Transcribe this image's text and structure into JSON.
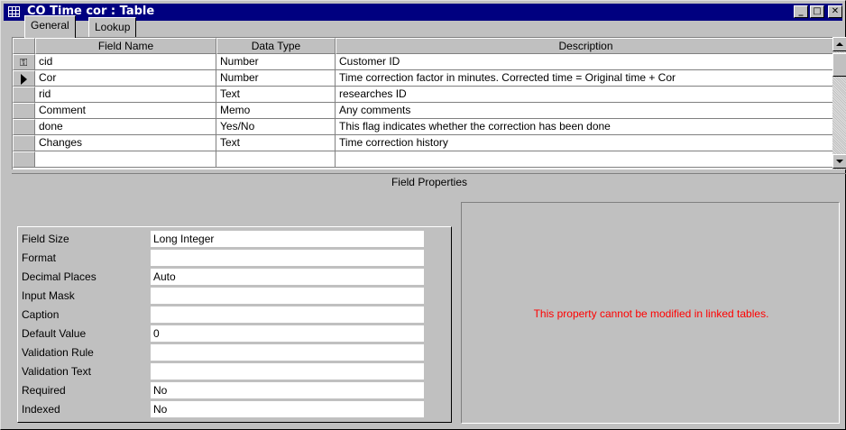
{
  "window": {
    "title": "CO Time cor : Table",
    "controls": {
      "minimize": "_",
      "maximize": "□",
      "close": "✕"
    }
  },
  "grid": {
    "columns": [
      "Field Name",
      "Data Type",
      "Description"
    ],
    "rows": [
      {
        "name": "cid",
        "type": "Number",
        "description": "Customer ID",
        "indicator": "key-icon"
      },
      {
        "name": "Cor",
        "type": "Number",
        "description": "Time correction factor in minutes. Corrected time = Original time + Cor",
        "indicator": "current-row-arrow"
      },
      {
        "name": "rid",
        "type": "Text",
        "description": "researches ID",
        "indicator": ""
      },
      {
        "name": "Comment",
        "type": "Memo",
        "description": "Any comments",
        "indicator": ""
      },
      {
        "name": "done",
        "type": "Yes/No",
        "description": "This flag indicates whether the correction has been done",
        "indicator": ""
      },
      {
        "name": "Changes",
        "type": "Text",
        "description": "Time correction history",
        "indicator": ""
      },
      {
        "name": "",
        "type": "",
        "description": "",
        "indicator": ""
      }
    ]
  },
  "field_properties": {
    "header": "Field Properties",
    "tabs": [
      "General",
      "Lookup"
    ],
    "active_tab": "General",
    "properties": [
      {
        "label": "Field Size",
        "value": "Long Integer"
      },
      {
        "label": "Format",
        "value": ""
      },
      {
        "label": "Decimal Places",
        "value": "Auto"
      },
      {
        "label": "Input Mask",
        "value": ""
      },
      {
        "label": "Caption",
        "value": ""
      },
      {
        "label": "Default Value",
        "value": "0"
      },
      {
        "label": "Validation Rule",
        "value": ""
      },
      {
        "label": "Validation Text",
        "value": ""
      },
      {
        "label": "Required",
        "value": "No"
      },
      {
        "label": "Indexed",
        "value": "No"
      }
    ],
    "help_text": "This property cannot be modified in linked tables."
  },
  "colors": {
    "titlebar": "#000080",
    "face": "#c0c0c0",
    "help_text": "#ff0000"
  }
}
